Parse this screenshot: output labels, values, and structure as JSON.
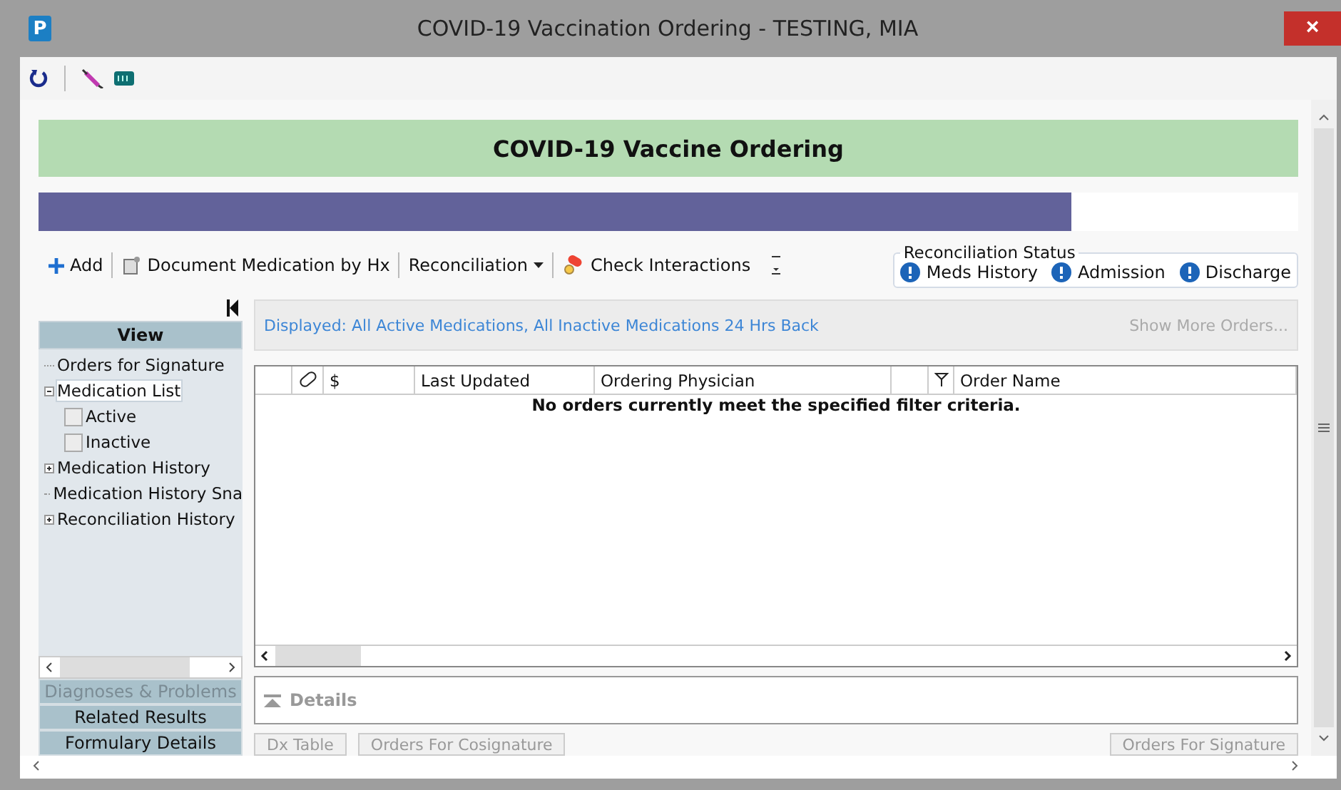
{
  "window": {
    "app_icon": "P",
    "title": "COVID-19 Vaccination Ordering - TESTING, MIA",
    "close": "×"
  },
  "banner": {
    "title": "COVID-19 Vaccine Ordering",
    "level": 0.82
  },
  "toolbar": {
    "items": [
      {
        "kind": "add",
        "label": "Add"
      },
      {
        "kind": "document",
        "label": "Document Medication by Hx"
      },
      {
        "kind": "menu",
        "label": "Reconciliation"
      },
      {
        "kind": "check",
        "label": "Check Interactions"
      }
    ]
  },
  "reconciliation_status": {
    "title": "Reconciliation Status",
    "items": [
      "Meds History",
      "Admission",
      "Discharge"
    ]
  },
  "view": {
    "title": "View",
    "tree": [
      {
        "label": "Orders for Signature",
        "selected": false
      },
      {
        "label": "Medication List",
        "selected": true,
        "expanded": true,
        "children": [
          {
            "label": "Active",
            "checked": false,
            "selected": false
          },
          {
            "label": "Inactive",
            "checked": false,
            "selected": false
          }
        ]
      },
      {
        "label": "Medication History",
        "selected": false,
        "expanded": false
      },
      {
        "label": "Medication History Sna",
        "selected": false
      },
      {
        "label": "Reconciliation History",
        "selected": false,
        "expanded": false
      }
    ],
    "sections": [
      {
        "label": "Diagnoses & Problems",
        "disabled": true
      },
      {
        "label": "Related Results",
        "disabled": false
      },
      {
        "label": "Formulary Details",
        "disabled": false
      }
    ]
  },
  "filter": {
    "displayed": "Displayed: All Active Medications, All Inactive Medications 24 Hrs Back",
    "more": "Show More Orders..."
  },
  "table": {
    "columns": [
      {
        "kind": "blank"
      },
      {
        "kind": "pill"
      },
      {
        "kind": "text",
        "label": "$"
      },
      {
        "kind": "text",
        "label": "Last Updated"
      },
      {
        "kind": "text",
        "label": "Ordering Physician"
      },
      {
        "kind": "blank"
      },
      {
        "kind": "flag"
      },
      {
        "kind": "text",
        "label": "Order Name"
      }
    ],
    "empty": "No orders currently meet the specified filter criteria."
  },
  "details": {
    "label": "Details"
  },
  "buttons": [
    "Dx Table",
    "Orders For Cosignature",
    "Orders For Signature"
  ]
}
